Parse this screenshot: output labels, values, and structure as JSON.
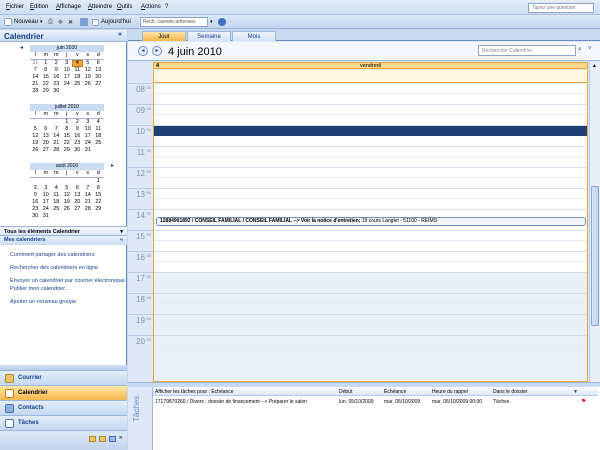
{
  "menu": [
    "Fichier",
    "Edition",
    "Affichage",
    "Atteindre",
    "Outils",
    "Actions",
    "?"
  ],
  "help_placeholder": "Tapez une question",
  "toolbar": {
    "new_label": "Nouveau",
    "today_label": "Aujourd'hui",
    "address_search": "Rech. carnets adresses"
  },
  "left": {
    "title": "Calendrier",
    "collapse": "«",
    "calendars": [
      {
        "month": "juin 2010",
        "dow": [
          "l",
          "m",
          "m",
          "j",
          "v",
          "s",
          "d"
        ],
        "weeks": [
          [
            "31",
            "1",
            "2",
            "3",
            "4",
            "5",
            "6"
          ],
          [
            "7",
            "8",
            "9",
            "10",
            "11",
            "12",
            "13"
          ],
          [
            "14",
            "15",
            "16",
            "17",
            "18",
            "19",
            "20"
          ],
          [
            "21",
            "22",
            "23",
            "24",
            "25",
            "26",
            "27"
          ],
          [
            "28",
            "29",
            "30",
            "",
            "",
            "",
            ""
          ]
        ]
      },
      {
        "month": "juillet 2010",
        "dow": [
          "l",
          "m",
          "m",
          "j",
          "v",
          "s",
          "d"
        ],
        "weeks": [
          [
            "",
            "",
            "",
            "1",
            "2",
            "3",
            "4"
          ],
          [
            "5",
            "6",
            "7",
            "8",
            "9",
            "10",
            "11"
          ],
          [
            "12",
            "13",
            "14",
            "15",
            "16",
            "17",
            "18"
          ],
          [
            "19",
            "20",
            "21",
            "22",
            "23",
            "24",
            "25"
          ],
          [
            "26",
            "27",
            "28",
            "29",
            "30",
            "31",
            ""
          ]
        ]
      },
      {
        "month": "août 2010",
        "dow": [
          "l",
          "m",
          "m",
          "j",
          "v",
          "s",
          "d"
        ],
        "weeks": [
          [
            "",
            "",
            "",
            "",
            "",
            "",
            "1"
          ],
          [
            "2",
            "3",
            "4",
            "5",
            "6",
            "7",
            "8"
          ],
          [
            "9",
            "10",
            "11",
            "12",
            "13",
            "14",
            "15"
          ],
          [
            "16",
            "17",
            "18",
            "19",
            "20",
            "21",
            "22"
          ],
          [
            "23",
            "24",
            "25",
            "26",
            "27",
            "28",
            "29"
          ],
          [
            "30",
            "31",
            "",
            "",
            "",
            "",
            ""
          ]
        ]
      }
    ],
    "all_items": "Tous les éléments Calendrier",
    "my_calendars": "Mes calendriers",
    "links": [
      "Comment partager des calendriers",
      "Rechercher des calendriers en ligne",
      "Envoyer un calendrier par courrier électronique...",
      "Publier mon calendrier...",
      "Ajouter un nouveau groupe"
    ],
    "nav": [
      "Courrier",
      "Calendrier",
      "Contacts",
      "Tâches"
    ]
  },
  "main": {
    "tabs": [
      "Jour",
      "Semaine",
      "Mois"
    ],
    "date_title": "4 juin 2010",
    "search_placeholder": "Rechercher Calendrier",
    "day_num": "4",
    "day_name": "vendredi",
    "hours": [
      "08",
      "09",
      "10",
      "11",
      "12",
      "13",
      "14",
      "15",
      "16",
      "17",
      "18",
      "19",
      "20"
    ],
    "minutes": "00",
    "appointment": {
      "title": "12884901892 / CONSEIL FAMILIAL / CONSEIL FAMILIAL --> Voir la notice d'entretien;",
      "location": " 19 cours Langlet - 51100 - REIMS"
    }
  },
  "tasks": {
    "label": "Tâches",
    "headers": {
      "show": "Afficher les tâches pour : Échéance",
      "start": "Début",
      "due": "Échéance",
      "reminder": "Heure du rappel",
      "folder": "Dans le dossier"
    },
    "row": {
      "subject": "17179870260 / Divers : dossier de financement --> Préparer le salon",
      "start": "lun. 05/10/2009",
      "due": "mar. 06/10/2009",
      "reminder": "mar. 06/10/2009 00:00",
      "folder": "Tâches"
    }
  },
  "colors": {
    "accent": "#f2a53a",
    "selected_slot": "#1e3f73",
    "header_text": "#15428b"
  }
}
